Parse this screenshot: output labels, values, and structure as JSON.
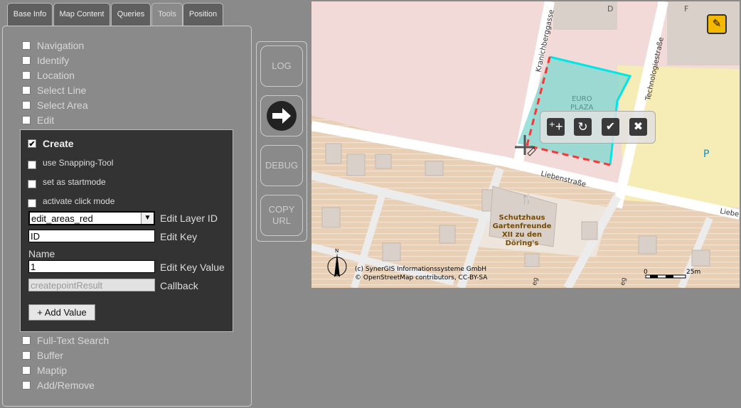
{
  "tabs": [
    {
      "label": "Base Info"
    },
    {
      "label": "Map Content"
    },
    {
      "label": "Queries"
    },
    {
      "label": "Tools",
      "active": true
    },
    {
      "label": "Position"
    }
  ],
  "tools_top": [
    {
      "label": "Navigation"
    },
    {
      "label": "Identify"
    },
    {
      "label": "Location"
    },
    {
      "label": "Select Line"
    },
    {
      "label": "Select Area"
    },
    {
      "label": "Edit"
    }
  ],
  "create": {
    "title": "Create",
    "checked": true,
    "options": [
      {
        "label": "use Snapping-Tool"
      },
      {
        "label": "set as startmode"
      },
      {
        "label": "activate click mode"
      }
    ],
    "layer_select": {
      "value": "edit_areas_red",
      "label": "Edit Layer ID"
    },
    "edit_key": {
      "value": "ID",
      "label": "Edit Key"
    },
    "name_label": "Name",
    "edit_key_value": {
      "value": "1",
      "label": "Edit Key Value"
    },
    "callback": {
      "value": "createpointResult",
      "label": "Callback"
    },
    "add_value_label": "+ Add Value"
  },
  "tools_bottom": [
    {
      "label": "Full-Text Search"
    },
    {
      "label": "Buffer"
    },
    {
      "label": "Maptip"
    },
    {
      "label": "Add/Remove"
    }
  ],
  "side_buttons": {
    "log": "LOG",
    "debug": "DEBUG",
    "copy_url": "COPY URL"
  },
  "map": {
    "labels": {
      "d": "D",
      "f": "F",
      "kranich": "Kranichberggasse",
      "techno": "Technologiestraße",
      "euro": "EURO",
      "plaza": "PLAZA",
      "lieben": "Liebenstraße",
      "lieben2": "Liebe",
      "parking": "P",
      "poi": [
        "Schutzhaus",
        "Gartenfreunde",
        "XII zu den",
        "Döring's"
      ],
      "eg1": "eg",
      "eg2": "eg"
    },
    "north": "N",
    "attribution": [
      "(c) SynerGIS Informationssysteme GmbH",
      "© OpenStreetMap contributors, CC-BY-SA"
    ],
    "scale": {
      "start": "0",
      "end": "25m"
    },
    "colors": {
      "edit_polygon": "#ff3333",
      "existing_polygon": "#00e5e5",
      "accent": "#f5b800"
    }
  }
}
